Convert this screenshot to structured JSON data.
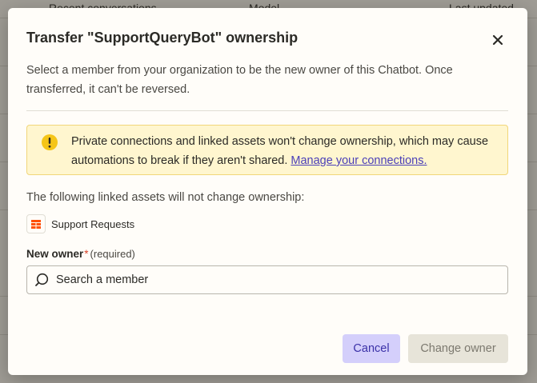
{
  "background": {
    "columns": [
      "Recent conversations",
      "Model",
      "Last updated"
    ]
  },
  "modal": {
    "title": "Transfer \"SupportQueryBot\" ownership",
    "description": "Select a member from your organization to be the new owner of this Chatbot. Once transferred, it can't be reversed.",
    "warning": {
      "text": "Private connections and linked assets won't change ownership, which may cause automations to break if they aren't shared. ",
      "link": "Manage your connections."
    },
    "assets_label": "The following linked assets will not change ownership:",
    "assets": [
      {
        "name": "Support Requests",
        "icon": "table-icon"
      }
    ],
    "owner_field": {
      "label": "New owner",
      "required_mark": "*",
      "required_text": "(required)",
      "placeholder": "Search a member"
    },
    "buttons": {
      "cancel": "Cancel",
      "change_owner": "Change owner"
    }
  },
  "colors": {
    "accent": "#3b31a8",
    "cancel_bg": "#d4cffb",
    "warning_bg": "#fff6cf",
    "warning_icon": "#f5c518",
    "table_icon": "#ff4f00",
    "required_star": "#d9442b"
  }
}
